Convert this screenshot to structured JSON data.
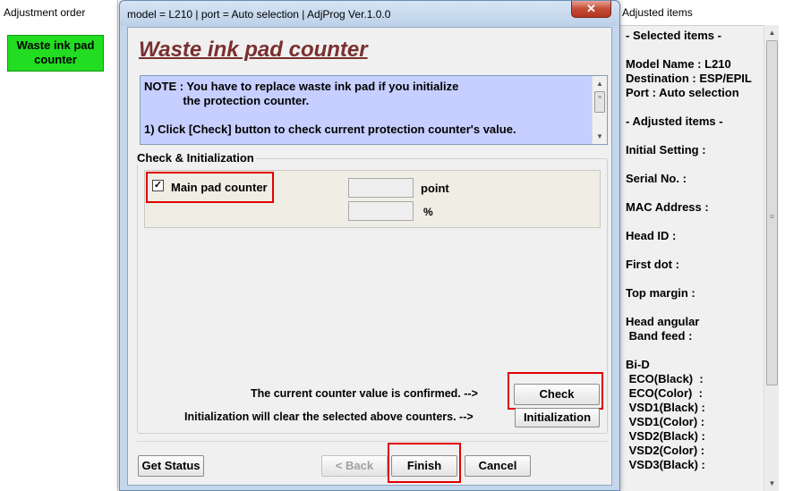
{
  "left_panel": {
    "title": "Adjustment order",
    "active_item": "Waste ink pad counter"
  },
  "dialog": {
    "title": "model = L210 | port = Auto selection | AdjProg Ver.1.0.0",
    "close_glyph": "✕",
    "heading": "Waste ink pad counter",
    "note": {
      "line1": "NOTE : You have to replace waste ink pad if you initialize",
      "line2": "            the protection counter.",
      "line3": "1) Click [Check] button to check current protection counter's value."
    },
    "group": {
      "label": "Check & Initialization",
      "checkbox_label": "Main pad counter",
      "checkbox_checked": true,
      "checkbox_glyph": "✓",
      "point_value": "",
      "point_unit": "point",
      "percent_value": "",
      "percent_unit": "%"
    },
    "check_text": "The current counter value is confirmed. -->",
    "init_text": "Initialization will clear the selected above counters. -->",
    "buttons": {
      "check": "Check",
      "initialization": "Initialization",
      "get_status": "Get Status",
      "back": "< Back",
      "finish": "Finish",
      "cancel": "Cancel"
    }
  },
  "right_panel": {
    "title": "Adjusted items",
    "lines": [
      "- Selected items -",
      "Model Name : L210",
      "Destination : ESP/EPIL",
      "Port : Auto selection",
      "- Adjusted items -",
      "Initial Setting :",
      "Serial No. :",
      "MAC Address :",
      "Head ID :",
      "First dot :",
      "Top margin :",
      "Head angular",
      " Band feed :",
      "Bi-D",
      " ECO(Black)  :",
      " ECO(Color)  :",
      " VSD1(Black) :",
      " VSD1(Color) :",
      " VSD2(Black) :",
      " VSD2(Color) :",
      " VSD3(Black) :"
    ]
  },
  "colors": {
    "highlight_red": "#e00000",
    "note_bg": "#c6cfff",
    "active_item_green": "#22dd22",
    "heading_color": "#7a2f2f"
  }
}
